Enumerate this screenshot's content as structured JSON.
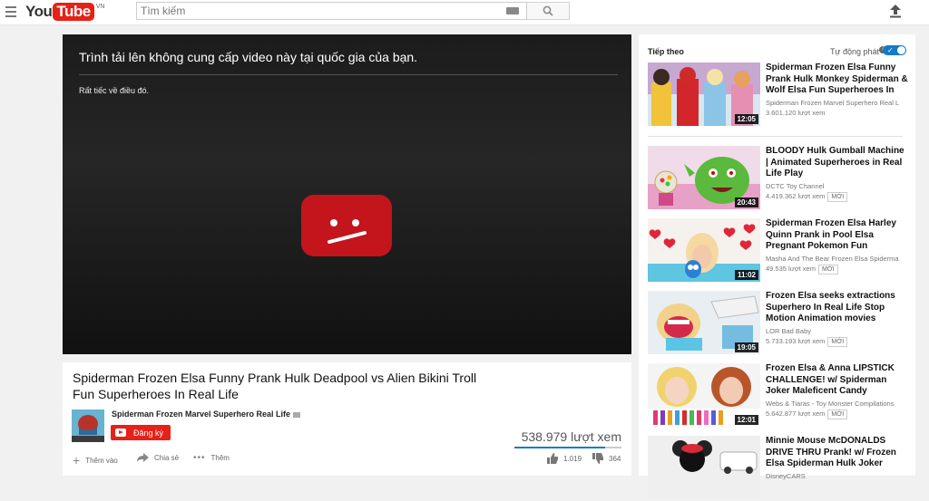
{
  "header": {
    "logo_you": "You",
    "logo_tube": "Tube",
    "logo_country": "VN",
    "search_placeholder": "Tìm kiếm"
  },
  "player": {
    "error_title": "Trình tải lên không cung cấp video này tại quốc gia của bạn.",
    "error_subtitle": "Rất tiếc về điều đó."
  },
  "video": {
    "title": "Spiderman Frozen Elsa Funny Prank Hulk Deadpool vs Alien Bikini Troll Fun Superheroes In Real Life",
    "channel": "Spiderman Frozen Marvel Superhero Real Life",
    "subscribe_label": "Đăng ký",
    "views": "538.979 lượt xem",
    "views_ratio": 0.85,
    "actions": {
      "add_label": "Thêm vào",
      "share_label": "Chia sẻ",
      "more_label": "Thêm",
      "likes": "1.019",
      "dislikes": "364"
    }
  },
  "sidebar": {
    "up_next_label": "Tiếp theo",
    "autoplay_label": "Tự động phát",
    "autoplay_on": true,
    "new_badge": "MỚI",
    "items": [
      {
        "title": "Spiderman Frozen Elsa Funny Prank Hulk Monkey Spiderman & Wolf Elsa Fun Superheroes In",
        "channel": "Spiderman Frozen Marvel Superhero Real L",
        "views": "3.601.120 lượt xem",
        "duration": "12:05",
        "is_new": false
      },
      {
        "title": "BLOODY Hulk Gumball Machine | Animated Superheroes in Real Life Play",
        "channel": "DCTC Toy Channel",
        "views": "4.419.362 lượt xem",
        "duration": "20:43",
        "is_new": true
      },
      {
        "title": "Spiderman Frozen Elsa Harley Quinn Prank in Pool Elsa Pregnant Pokemon Fun",
        "channel": "Masha And The Bear Frozen Elsa Spiderma",
        "views": "49.535 lượt xem",
        "duration": "11:02",
        "is_new": true
      },
      {
        "title": "Frozen Elsa seeks extractions Superhero In Real Life Stop Motion Animation movies",
        "channel": "LOR Bad Baby",
        "views": "5.733.193 lượt xem",
        "duration": "19:05",
        "is_new": true
      },
      {
        "title": "Frozen Elsa & Anna LIPSTICK CHALLENGE! w/ Spiderman Joker Maleficent Candy",
        "channel": "Webs & Tiaras - Toy Monster Compilations",
        "views": "5.642.877 lượt xem",
        "duration": "12:01",
        "is_new": true
      },
      {
        "title": "Minnie Mouse McDONALDS DRIVE THRU Prank! w/ Frozen Elsa Spiderman Hulk Joker",
        "channel": "DisneyCARS",
        "views": "",
        "duration": "",
        "is_new": false
      }
    ]
  }
}
